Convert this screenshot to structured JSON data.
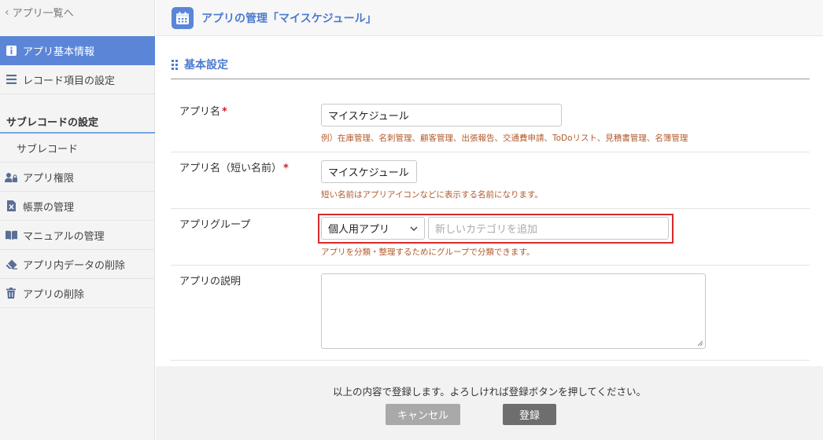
{
  "sidebar": {
    "back_label": "アプリ一覧へ",
    "items": [
      {
        "label": "アプリ基本情報",
        "icon": "info-icon",
        "active": true
      },
      {
        "label": "レコード項目の設定",
        "icon": "list-icon"
      }
    ],
    "sub_heading": "サブレコードの設定",
    "sub_items": [
      {
        "label": "サブレコード"
      },
      {
        "label": "アプリ権限",
        "icon": "user-lock-icon"
      },
      {
        "label": "帳票の管理",
        "icon": "excel-file-icon"
      },
      {
        "label": "マニュアルの管理",
        "icon": "book-icon"
      },
      {
        "label": "アプリ内データの削除",
        "icon": "eraser-icon"
      },
      {
        "label": "アプリの削除",
        "icon": "trash-icon"
      }
    ]
  },
  "header": {
    "title": "アプリの管理「マイスケジュール」",
    "icon": "calendar-icon"
  },
  "section": {
    "title": "基本設定"
  },
  "form": {
    "app_name": {
      "label": "アプリ名",
      "required_mark": "*",
      "value": "マイスケジュール",
      "hint": "例）在庫管理、名刺管理、顧客管理、出張報告、交通費申請、ToDoリスト、見積書管理、名簿管理"
    },
    "short_name": {
      "label": "アプリ名（短い名前）",
      "required_mark": "*",
      "value": "マイスケジュール",
      "hint": "短い名前はアプリアイコンなどに表示する名前になります。"
    },
    "group": {
      "label": "アプリグループ",
      "selected": "個人用アプリ",
      "new_category_placeholder": "新しいカテゴリを追加",
      "hint": "アプリを分類・整理するためにグループで分類できます。"
    },
    "description": {
      "label": "アプリの説明",
      "value": ""
    }
  },
  "footer": {
    "message": "以上の内容で登録します。よろしければ登録ボタンを押してください。",
    "cancel_label": "キャンセル",
    "save_label": "登録"
  },
  "colors": {
    "accent": "#5b86d8",
    "highlight_border": "#d62a2a",
    "hint_text": "#b25a2a"
  }
}
